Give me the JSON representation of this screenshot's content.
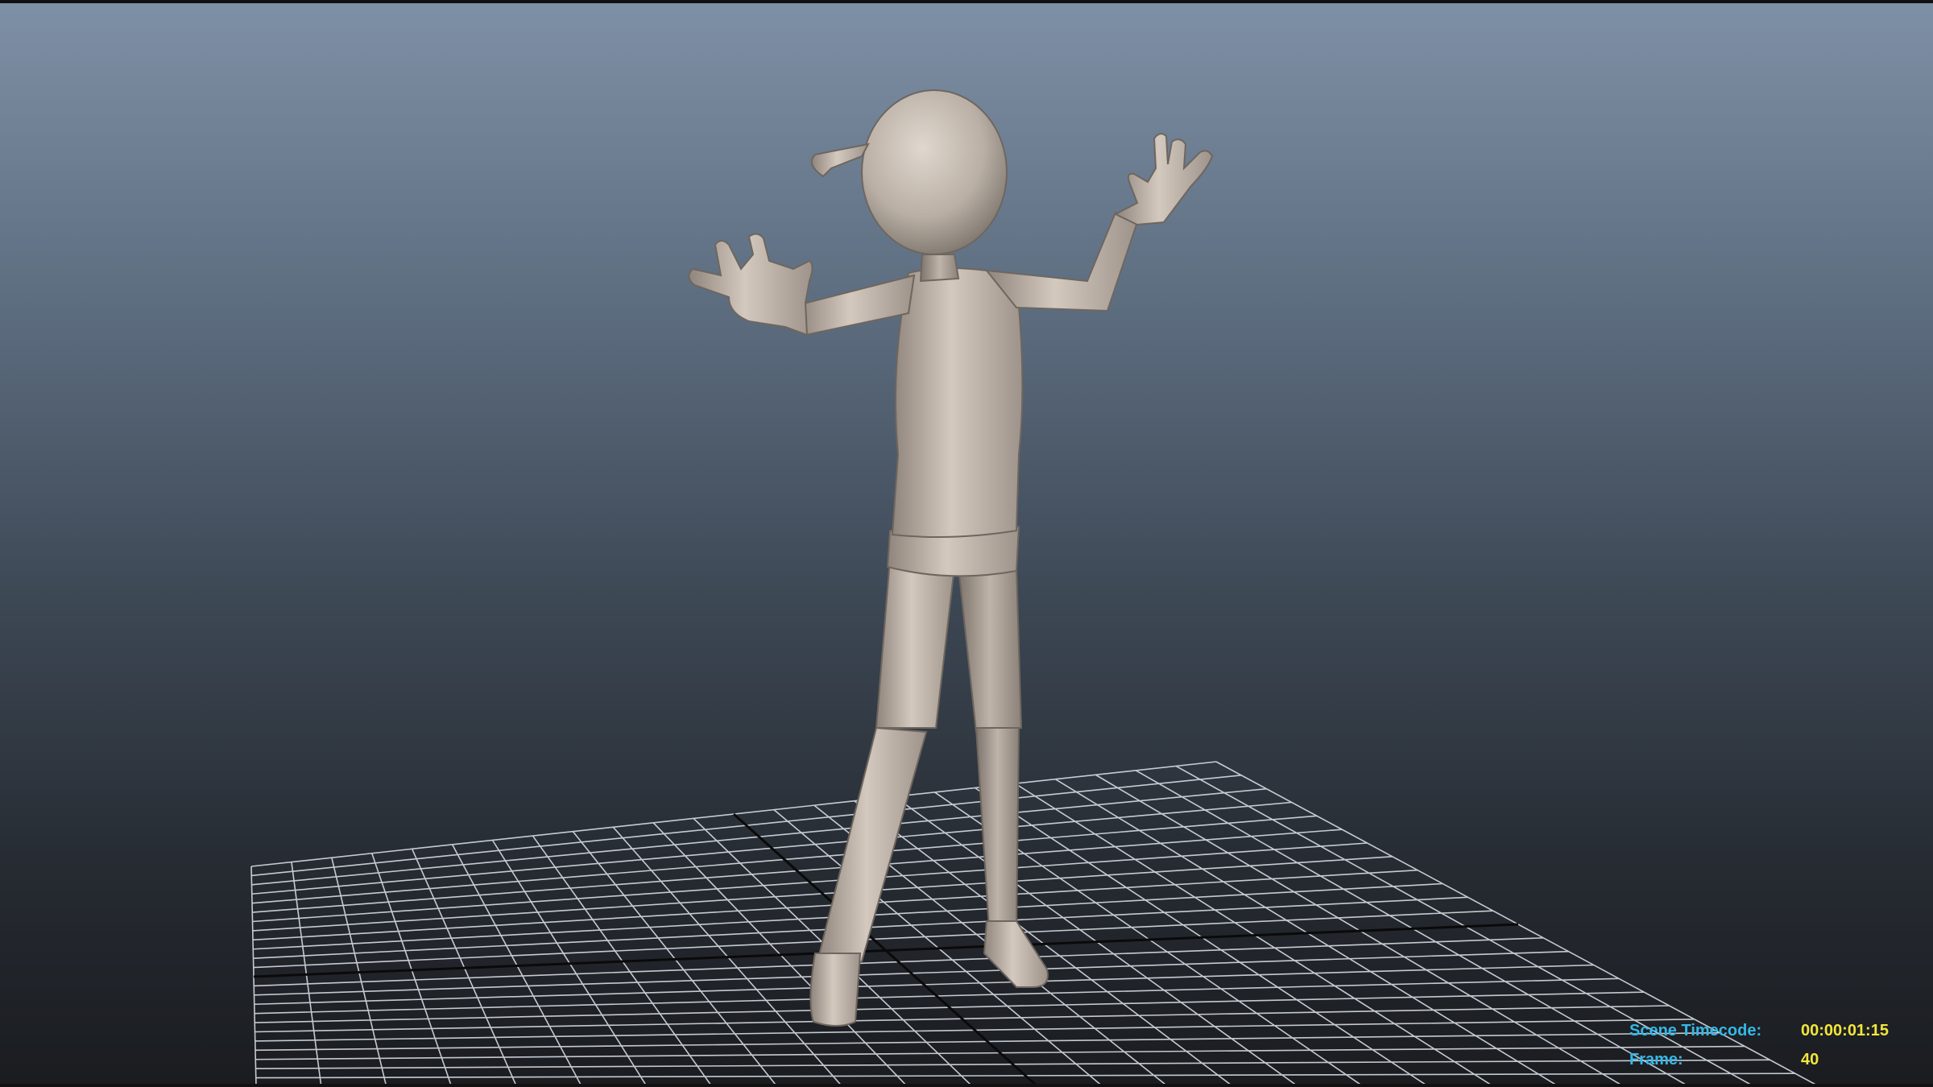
{
  "viewport": {
    "background_top": "#7e90a5",
    "background_bottom": "#1a1c20",
    "grid_color": "#d8dde4",
    "grid_axis_color": "#0a0a0a",
    "model_color": "#c8bdb3"
  },
  "hud": {
    "timecode_label": "Scene Timecode:",
    "timecode_value": "00:00:01:15",
    "frame_label": "Frame:",
    "frame_value": "40",
    "label_color": "#35b8e8",
    "value_color": "#f2e63c"
  }
}
